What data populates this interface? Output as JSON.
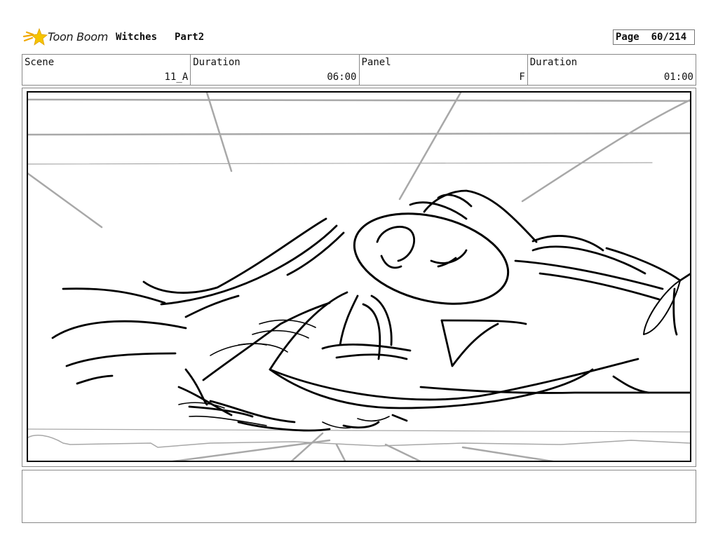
{
  "header": {
    "logo_text": "Toon Boom",
    "project_title": "Witches",
    "part": "Part2",
    "page_label": "Page",
    "page_value": "60/214"
  },
  "info": {
    "scene_label": "Scene",
    "scene_value": "11_A",
    "scene_duration_label": "Duration",
    "scene_duration_value": "06:00",
    "panel_label": "Panel",
    "panel_value": "F",
    "panel_duration_label": "Duration",
    "panel_duration_value": "01:00"
  },
  "colors": {
    "logo_star": "#f5c400",
    "logo_trail": "#f0a800",
    "sketch_ink": "#000000",
    "sketch_guides": "#a8a8a8"
  },
  "icons": {
    "logo": "toon-boom-star-logo"
  },
  "notes": {
    "text": ""
  }
}
